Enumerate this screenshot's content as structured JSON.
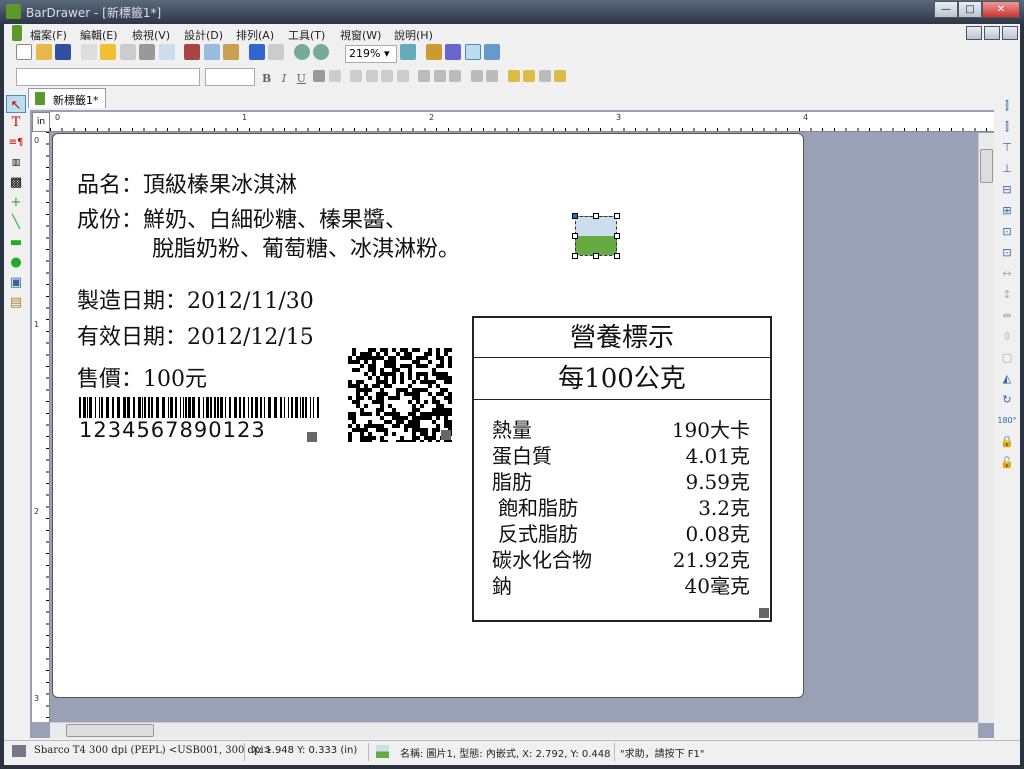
{
  "window": {
    "title": "BarDrawer - [新標籤1*]",
    "min": "—",
    "max": "□",
    "close": "✕"
  },
  "menu": [
    "檔案(F)",
    "編輯(E)",
    "檢視(V)",
    "設計(D)",
    "排列(A)",
    "工具(T)",
    "視窗(W)",
    "說明(H)"
  ],
  "toolbar": {
    "zoom": "219%",
    "bold": "B",
    "italic": "I",
    "underline": "U"
  },
  "tab": {
    "label": "新標籤1*"
  },
  "ruler": {
    "unit": "in",
    "h_labels": [
      "0",
      "1",
      "2",
      "3",
      "4"
    ],
    "v_labels": [
      "0",
      "1",
      "2",
      "3"
    ]
  },
  "label": {
    "line1": "品名：頂級榛果冰淇淋",
    "line2": "成份：鮮奶、白細砂糖、榛果醬、",
    "line3": "脫脂奶粉、葡萄糖、冰淇淋粉。",
    "line4": "製造日期：2012/11/30",
    "line5": "有效日期：2012/12/15",
    "line6": "售價：100元",
    "barcode_text": "1234567890123"
  },
  "nutrition": {
    "title": "營養標示",
    "serving": "每100公克",
    "rows": [
      {
        "name": "熱量",
        "value": "190大卡"
      },
      {
        "name": "蛋白質",
        "value": "4.01克"
      },
      {
        "name": "脂肪",
        "value": "9.59克"
      },
      {
        "name": "飽和脂肪",
        "value": "3.2克"
      },
      {
        "name": "反式脂肪",
        "value": "0.08克"
      },
      {
        "name": "碳水化合物",
        "value": "21.92克"
      },
      {
        "name": "鈉",
        "value": "40毫克"
      }
    ]
  },
  "status": {
    "printer": "Sbarco T4 300 dpi (PEPL) <USB001, 300 dpi>",
    "coords": "X: 1.948  Y: 0.333 (in)",
    "object": "名稱: 圖片1, 型態: 內嵌式, X: 2.792, Y: 0.448",
    "help": "\"求助，請按下 F1\""
  }
}
